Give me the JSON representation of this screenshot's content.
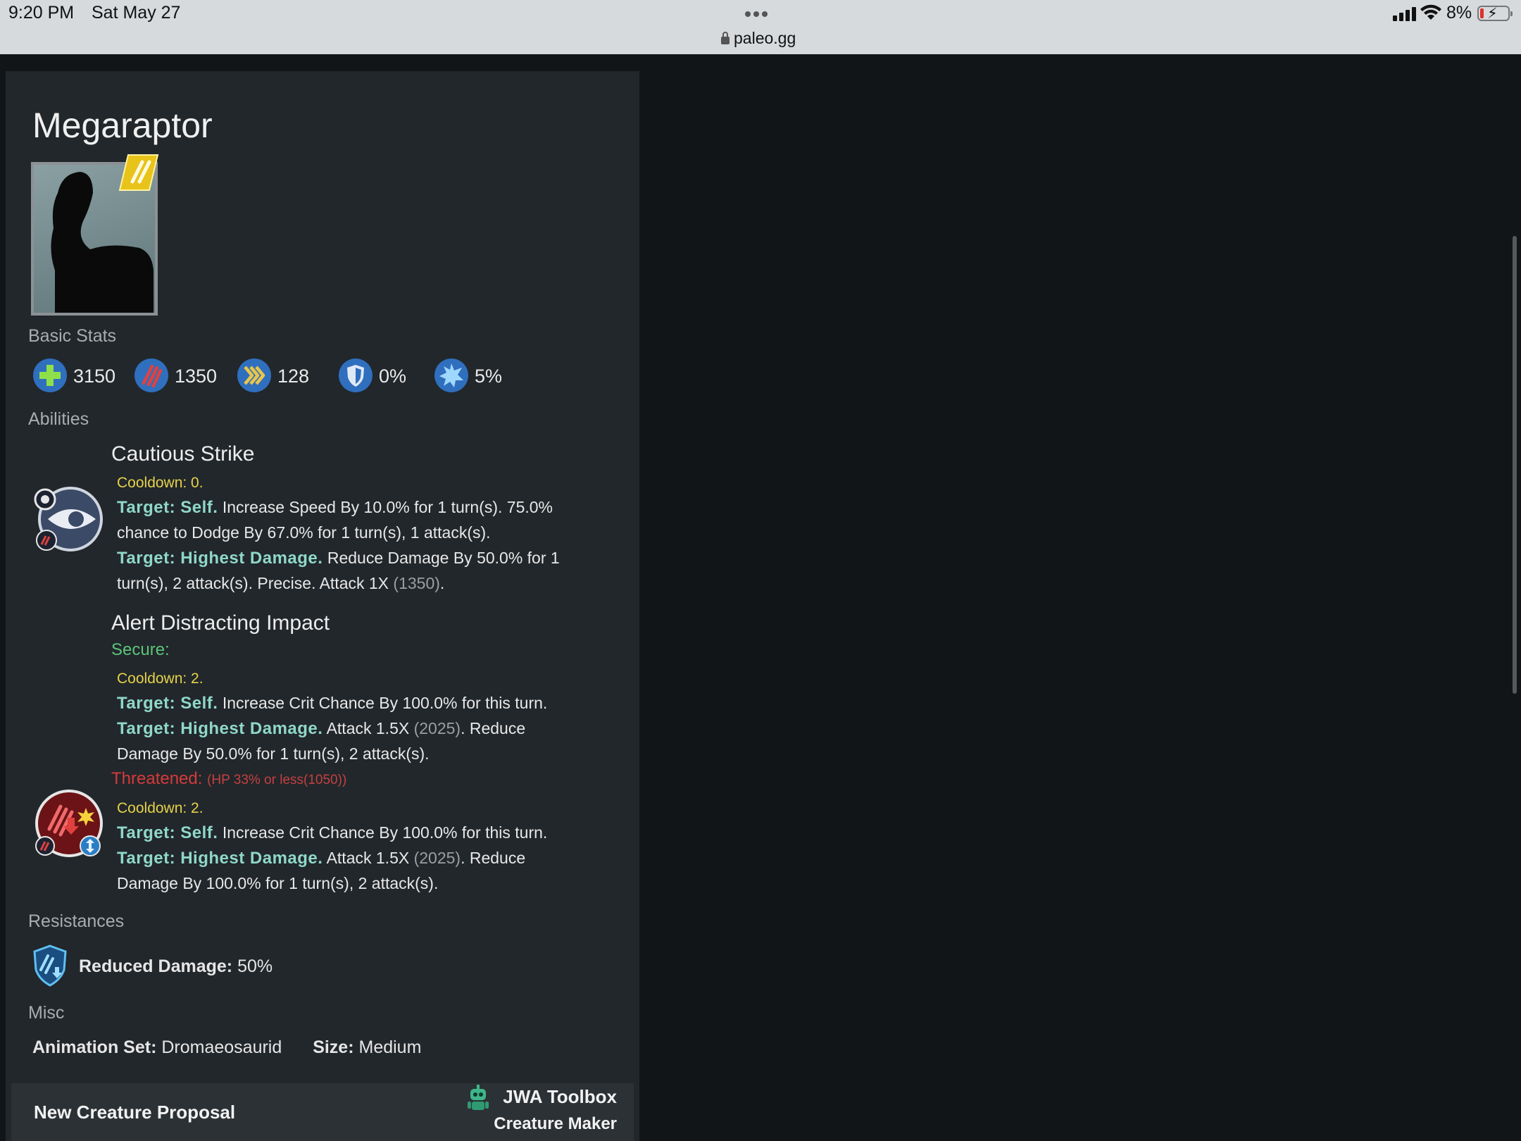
{
  "status_bar": {
    "time": "9:20 PM",
    "date": "Sat May 27",
    "url": "paleo.gg",
    "battery": "8%"
  },
  "creature": {
    "name": "Megaraptor",
    "rarity_badge_icon": "legendary-claw-badge"
  },
  "sections": {
    "basic_stats": "Basic Stats",
    "abilities": "Abilities",
    "resistances": "Resistances",
    "misc": "Misc"
  },
  "stats": [
    {
      "icon": "health-icon",
      "value": "3150"
    },
    {
      "icon": "damage-icon",
      "value": "1350"
    },
    {
      "icon": "speed-icon",
      "value": "128"
    },
    {
      "icon": "armor-icon",
      "value": "0%"
    },
    {
      "icon": "crit-icon",
      "value": "5%"
    }
  ],
  "abilities": [
    {
      "name": "Cautious Strike",
      "cooldown": "Cooldown: 0.",
      "l1_target": "Target: Self.",
      "l1_text": "Increase Speed By 10.0% for 1 turn(s). 75.0%",
      "l2_text": "chance to Dodge By 67.0% for 1 turn(s), 1 attack(s).",
      "l3_target": "Target: Highest Damage.",
      "l3_text": "Reduce Damage By 50.0% for 1",
      "l4_text": "turn(s), 2 attack(s). Precise. Attack 1X",
      "l4_value": "(1350)",
      "l4_end": "."
    },
    {
      "name": "Alert Distracting Impact",
      "secure_label": "Secure:",
      "secure": {
        "cooldown": "Cooldown: 2.",
        "l1_target": "Target: Self.",
        "l1_text": "Increase Crit Chance By 100.0% for this turn.",
        "l2_target": "Target: Highest Damage.",
        "l2_text": "Attack 1.5X",
        "l2_value": "(2025)",
        "l2_end": ". Reduce",
        "l3_text": "Damage By 50.0% for 1 turn(s), 2 attack(s)."
      },
      "threatened_label": "Threatened:",
      "threatened_cond": "(HP 33% or less(1050))",
      "threatened": {
        "cooldown": "Cooldown: 2.",
        "l1_target": "Target: Self.",
        "l1_text": "Increase Crit Chance By 100.0% for this turn.",
        "l2_target": "Target: Highest Damage.",
        "l2_text": "Attack 1.5X",
        "l2_value": "(2025)",
        "l2_end": ". Reduce",
        "l3_text": "Damage By 100.0% for 1 turn(s), 2 attack(s)."
      }
    }
  ],
  "resistances": [
    {
      "label": "Reduced Damage:",
      "value": "50%"
    }
  ],
  "misc": {
    "anim_label": "Animation Set:",
    "anim_value": "Dromaeosaurid",
    "size_label": "Size:",
    "size_value": "Medium"
  },
  "footer": {
    "left": "New Creature Proposal",
    "brand": "JWA Toolbox",
    "sub": "Creature Maker"
  },
  "colors": {
    "accent_target": "#8fd8c8",
    "cooldown": "#e5d24a",
    "secure": "#5cc47a",
    "threatened": "#d63a3a"
  }
}
